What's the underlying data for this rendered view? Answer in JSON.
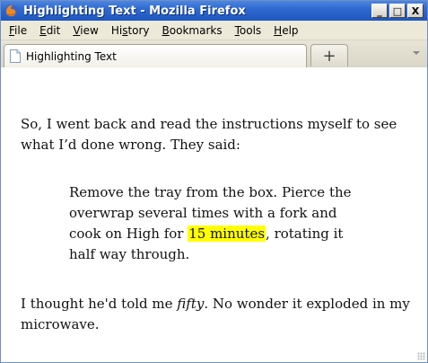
{
  "window": {
    "title": "Highlighting Text - Mozilla Firefox",
    "controls": {
      "minimize": "_",
      "maximize": "□",
      "close": "X"
    }
  },
  "menubar": {
    "items": [
      {
        "label": "File",
        "accel": "F",
        "rest": "ile"
      },
      {
        "label": "Edit",
        "accel": "E",
        "rest": "dit"
      },
      {
        "label": "View",
        "accel": "V",
        "rest": "iew"
      },
      {
        "label": "History",
        "pre": "Hi",
        "accel": "s",
        "rest": "tory"
      },
      {
        "label": "Bookmarks",
        "accel": "B",
        "rest": "ookmarks"
      },
      {
        "label": "Tools",
        "accel": "T",
        "rest": "ools"
      },
      {
        "label": "Help",
        "accel": "H",
        "rest": "elp"
      }
    ]
  },
  "tabs": {
    "active_label": "Highlighting Text",
    "new_tab_symbol": "+"
  },
  "content": {
    "para1": "So, I went back and read the instructions myself to see what I’d done wrong. They said:",
    "quote_before": "Remove the tray from the box. Pierce the overwrap several times with a fork and cook on High for ",
    "quote_highlight": "15 minutes",
    "quote_after": ", rotating it half way through.",
    "para2_before": "I thought he'd told me ",
    "para2_em": "fifty",
    "para2_after": ". No wonder it exploded in my microwave."
  },
  "colors": {
    "titlebar": "#2f6ad0",
    "highlight": "#ffff00",
    "chrome": "#ece9d8"
  }
}
